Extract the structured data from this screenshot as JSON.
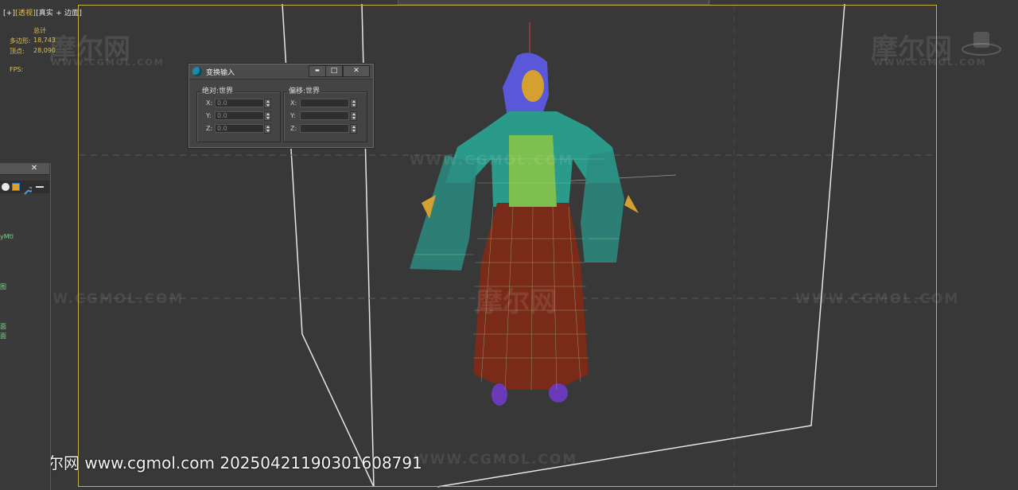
{
  "viewport": {
    "label_plus": "[+]",
    "label_view": "透视",
    "label_shading": "[真实 + 边面]",
    "stats": {
      "total_label": "总计",
      "poly_label": "多边形:",
      "poly_value": "18,743",
      "vert_label": "顶点:",
      "vert_value": "28,090",
      "fps_label": "FPS:"
    }
  },
  "watermarks": {
    "brand": "摩尔网",
    "site": "WWW.CGMOL.COM",
    "bottom": "摩尔网 www.cgmol.com 20250421190301608791"
  },
  "transform_dialog": {
    "title": "变换输入",
    "minimize": "▬",
    "maximize": "□",
    "close": "✕",
    "absolute": {
      "title": "绝对:世界",
      "x_label": "X:",
      "x_value": "0.0",
      "y_label": "Y:",
      "y_value": "0.0",
      "z_label": "Z:",
      "z_value": "0.0"
    },
    "offset": {
      "title": "偏移:世界",
      "x_label": "X:",
      "x_value": "",
      "y_label": "Y:",
      "y_value": "",
      "z_label": "Z:",
      "z_value": ""
    }
  },
  "side_panel": {
    "close": "✕",
    "text_1": "yMtl",
    "text_2": "图",
    "text_3": "面",
    "text_4": "面"
  },
  "colors": {
    "viewport_bg": "#383838",
    "frame_border": "#c8b040",
    "stat_text": "#e0c050"
  }
}
